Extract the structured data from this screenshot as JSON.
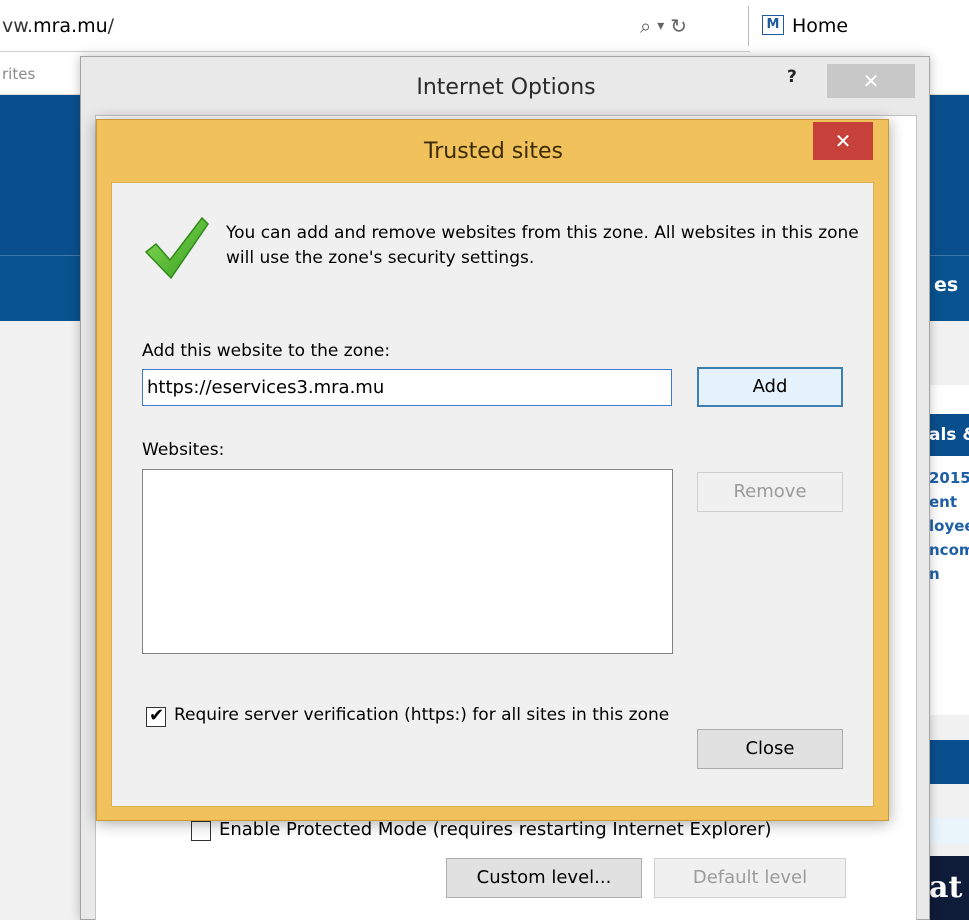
{
  "browser": {
    "address_prefix": "vw.",
    "address_domain": "mra.mu",
    "address_suffix": "/",
    "search_glyph": "⌕",
    "dropdown_glyph": "▾",
    "refresh_glyph": "↻",
    "home_tab_label": "Home",
    "favorites_partial": "rites"
  },
  "webpage": {
    "nav_partial": "es",
    "panel_heading_partial": "als &",
    "panel_links": [
      "2015",
      "ent",
      "loyee",
      "ncom",
      "n"
    ],
    "banner_partial": "at"
  },
  "internet_options": {
    "title": "Internet Options",
    "help_label": "?",
    "close_label": "✕",
    "protected_mode_label": "Enable Protected Mode (requires restarting Internet Explorer)",
    "protected_mode_checked": false,
    "custom_level_label": "Custom level...",
    "default_level_label": "Default level"
  },
  "trusted_sites": {
    "title": "Trusted sites",
    "close_label": "✕",
    "description": "You can add and remove websites from this zone. All websites in this zone will use the zone's security settings.",
    "add_label": "Add this website to the zone:",
    "add_value": "https://eservices3.mra.mu",
    "add_button": "Add",
    "websites_label": "Websites:",
    "websites": [],
    "remove_button": "Remove",
    "require_verification_label": "Require server verification (https:) for all sites in this zone",
    "require_verification_checked": true,
    "close_button": "Close"
  },
  "colors": {
    "trusted_frame": "#f1c25c",
    "close_red": "#c7403a",
    "check_green": "#4caf2a",
    "page_blue": "#0a4f8d"
  }
}
